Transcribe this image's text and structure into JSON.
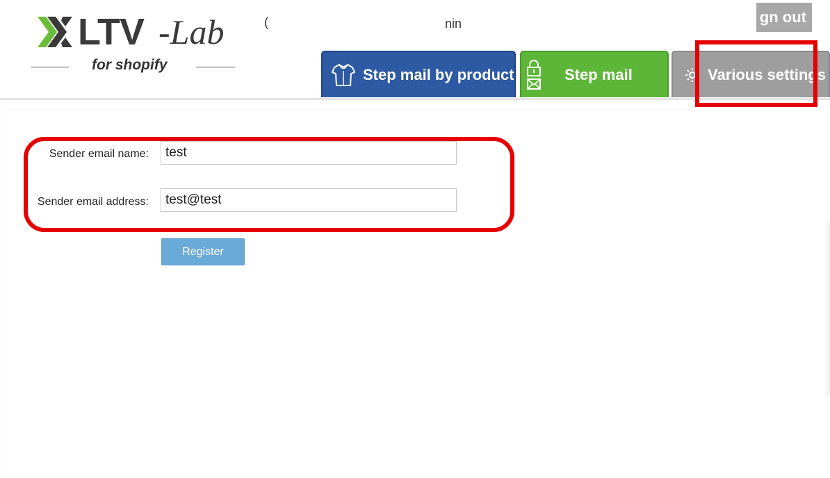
{
  "header": {
    "logo": {
      "brand": "LTV",
      "brand_suffix": "-Lab",
      "tagline": "for shopify"
    },
    "fragment_left": "(",
    "fragment_right": "nin",
    "signout_label": "gn out"
  },
  "tabs": [
    {
      "label": "Step mail by product",
      "icon": "shirt-icon",
      "color": "#2d5aa3"
    },
    {
      "label": "Step mail",
      "icon": "lock-mail-icon",
      "color": "#5db638"
    },
    {
      "label": "Various settings",
      "icon": "gear-icon",
      "color": "#9e9e9e"
    }
  ],
  "form": {
    "sender_name_label": "Sender email name:",
    "sender_name_value": "test",
    "sender_address_label": "Sender email address:",
    "sender_address_value": "test@test",
    "register_label": "Register"
  },
  "colors": {
    "highlight": "#e60000",
    "register_button": "#6aaad6"
  }
}
